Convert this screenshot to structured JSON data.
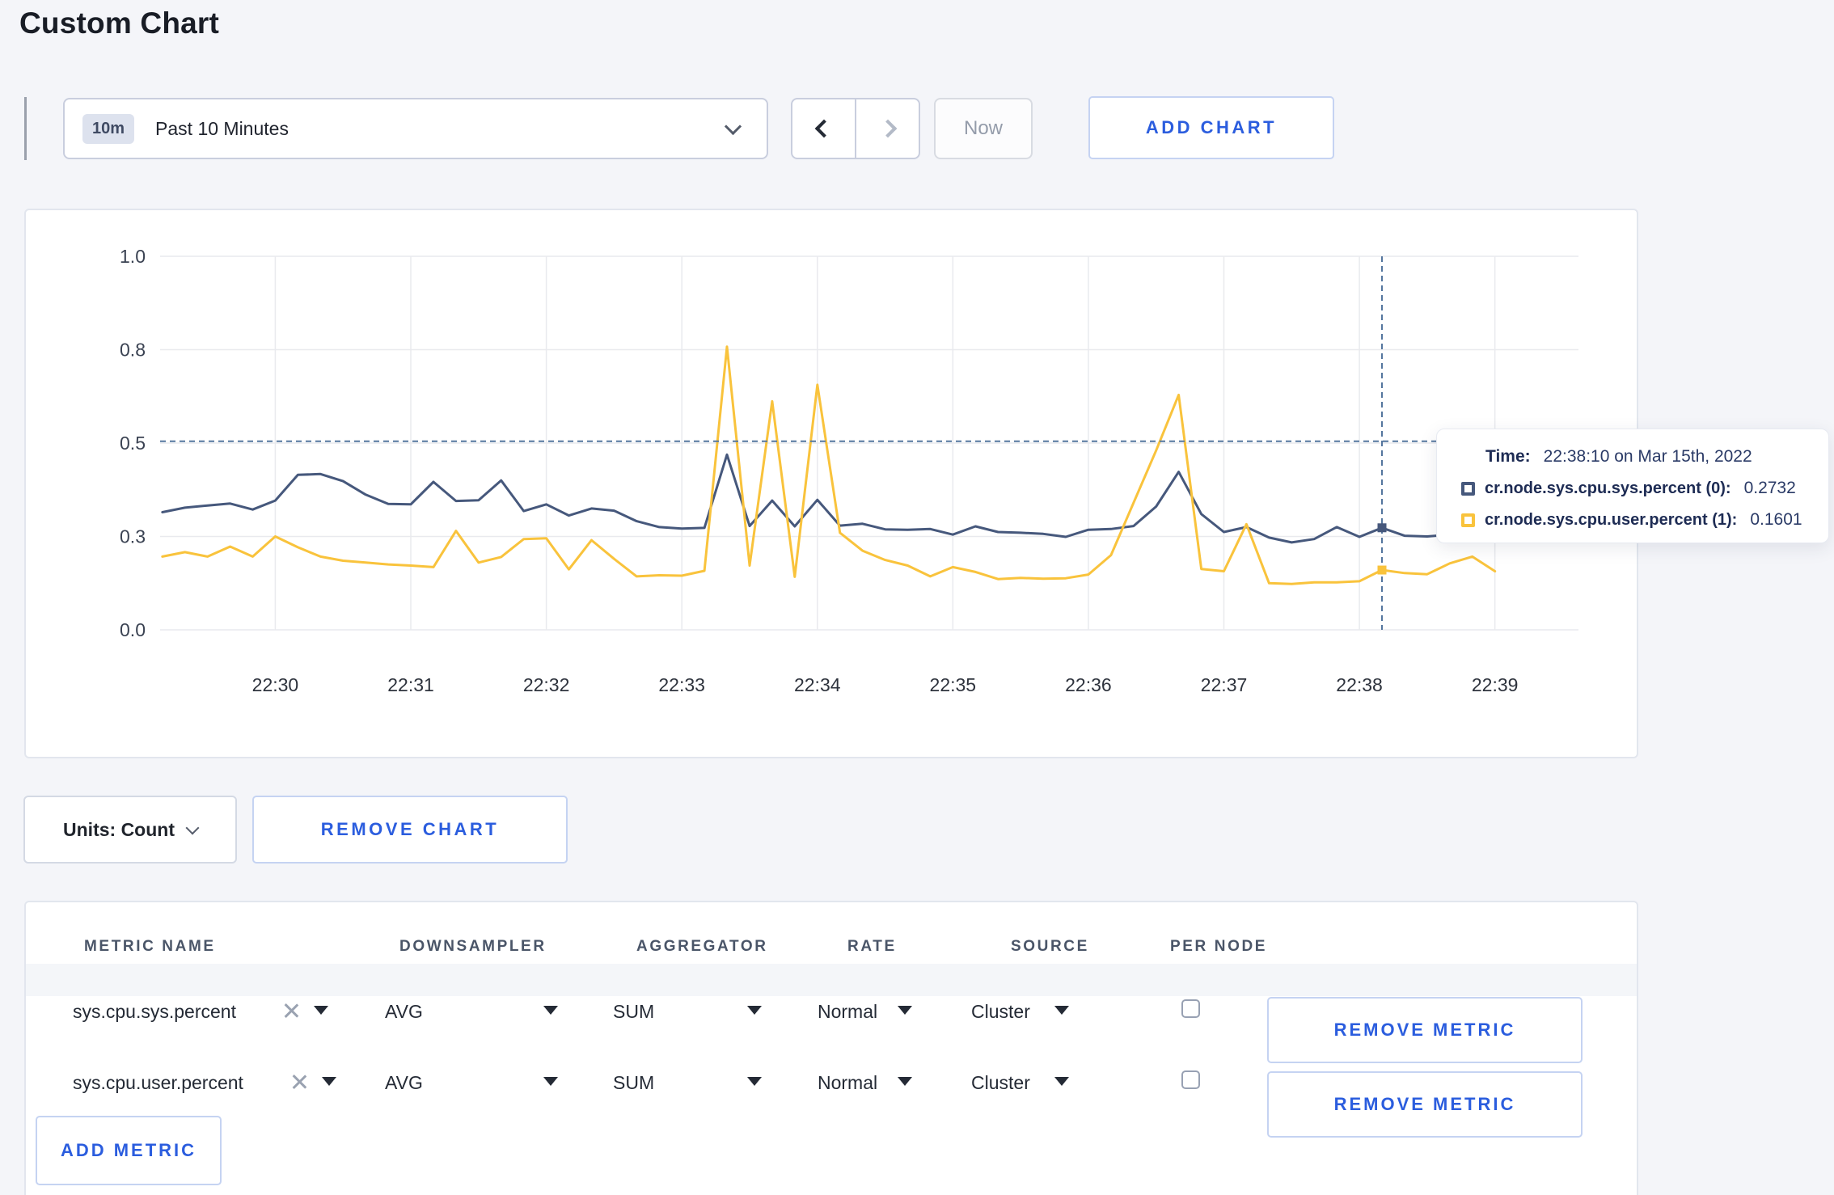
{
  "header": {
    "title": "Custom Chart"
  },
  "controls": {
    "time_badge": "10m",
    "time_label": "Past 10 Minutes",
    "now_label": "Now",
    "add_chart_label": "ADD CHART"
  },
  "chart_data": {
    "type": "line",
    "title": "",
    "xlabel": "",
    "ylabel": "",
    "x_unit": "seconds after 22:29:00 on Mar 15th, 2022",
    "x_domain": [
      9,
      637
    ],
    "y_domain": [
      0,
      1
    ],
    "grid": true,
    "grid_color": "#e9eaee",
    "y_ticks": [
      {
        "v": 0.0,
        "label": "0.0"
      },
      {
        "v": 0.25,
        "label": "0.3"
      },
      {
        "v": 0.5,
        "label": "0.5"
      },
      {
        "v": 0.75,
        "label": "0.8"
      },
      {
        "v": 1.0,
        "label": "1.0"
      }
    ],
    "x_ticks": [
      {
        "t": 60,
        "label": "22:30"
      },
      {
        "t": 120,
        "label": "22:31"
      },
      {
        "t": 180,
        "label": "22:32"
      },
      {
        "t": 240,
        "label": "22:33"
      },
      {
        "t": 300,
        "label": "22:34"
      },
      {
        "t": 360,
        "label": "22:35"
      },
      {
        "t": 420,
        "label": "22:36"
      },
      {
        "t": 480,
        "label": "22:37"
      },
      {
        "t": 540,
        "label": "22:38"
      },
      {
        "t": 600,
        "label": "22:39"
      }
    ],
    "series": [
      {
        "name": "cr.node.sys.cpu.sys.percent (0)",
        "color": "#46587c",
        "t_start": 10,
        "t_step": 10,
        "values": [
          0.315,
          0.327,
          0.333,
          0.338,
          0.322,
          0.346,
          0.415,
          0.417,
          0.398,
          0.362,
          0.337,
          0.336,
          0.396,
          0.345,
          0.347,
          0.4,
          0.318,
          0.336,
          0.306,
          0.325,
          0.319,
          0.291,
          0.275,
          0.271,
          0.273,
          0.469,
          0.278,
          0.346,
          0.277,
          0.348,
          0.279,
          0.284,
          0.269,
          0.268,
          0.27,
          0.255,
          0.277,
          0.262,
          0.26,
          0.257,
          0.249,
          0.268,
          0.27,
          0.278,
          0.33,
          0.423,
          0.31,
          0.262,
          0.275,
          0.247,
          0.234,
          0.243,
          0.275,
          0.249,
          0.2732,
          0.252,
          0.25,
          0.255,
          0.252,
          0.258
        ]
      },
      {
        "name": "cr.node.sys.cpu.user.percent (1)",
        "color": "#f9c33c",
        "t_start": 10,
        "t_step": 10,
        "values": [
          0.196,
          0.208,
          0.196,
          0.223,
          0.196,
          0.25,
          0.221,
          0.196,
          0.185,
          0.18,
          0.175,
          0.172,
          0.168,
          0.265,
          0.18,
          0.195,
          0.243,
          0.245,
          0.162,
          0.24,
          0.19,
          0.143,
          0.146,
          0.145,
          0.158,
          0.758,
          0.172,
          0.612,
          0.142,
          0.656,
          0.26,
          0.212,
          0.187,
          0.172,
          0.143,
          0.168,
          0.155,
          0.136,
          0.139,
          0.137,
          0.138,
          0.148,
          0.2,
          0.34,
          0.48,
          0.629,
          0.163,
          0.157,
          0.283,
          0.125,
          0.123,
          0.127,
          0.127,
          0.13,
          0.1601,
          0.152,
          0.149,
          0.178,
          0.196,
          0.157
        ]
      }
    ],
    "crosshair": {
      "t": 550,
      "y_frac": 0.505,
      "color": "#54769e"
    },
    "markers": [
      {
        "series": 0,
        "t": 550,
        "v": 0.2732
      },
      {
        "series": 1,
        "t": 550,
        "v": 0.1601
      }
    ],
    "legend_position": "tooltip"
  },
  "tooltip": {
    "time_label": "Time:",
    "time_value": "22:38:10 on Mar 15th, 2022",
    "series": [
      {
        "name_label": "cr.node.sys.cpu.sys.percent (0):",
        "value": "0.2732",
        "color": "#46587c"
      },
      {
        "name_label": "cr.node.sys.cpu.user.percent (1):",
        "value": "0.1601",
        "color": "#f9c33c"
      }
    ]
  },
  "units": {
    "label": "Units: Count",
    "remove_chart_label": "REMOVE CHART"
  },
  "table": {
    "headers": [
      "METRIC NAME",
      "DOWNSAMPLER",
      "AGGREGATOR",
      "RATE",
      "SOURCE",
      "PER NODE"
    ],
    "rows": [
      {
        "metric": "sys.cpu.sys.percent",
        "downsampler": "AVG",
        "aggregator": "SUM",
        "rate": "Normal",
        "source": "Cluster",
        "per_node_checked": false,
        "remove_label": "REMOVE METRIC"
      },
      {
        "metric": "sys.cpu.user.percent",
        "downsampler": "AVG",
        "aggregator": "SUM",
        "rate": "Normal",
        "source": "Cluster",
        "per_node_checked": false,
        "remove_label": "REMOVE METRIC"
      }
    ],
    "add_metric_label": "ADD METRIC"
  }
}
